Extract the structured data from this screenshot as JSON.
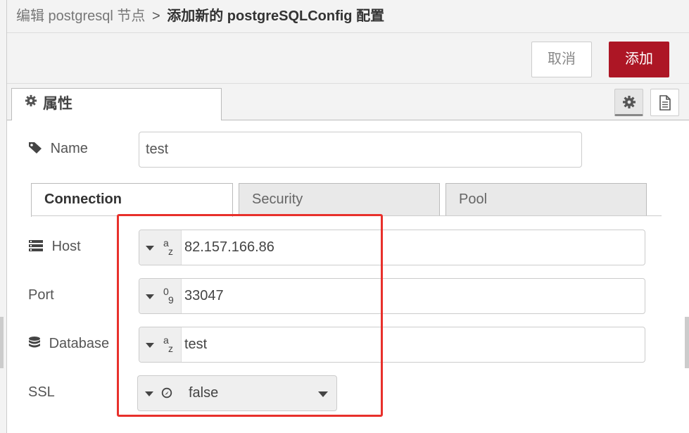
{
  "header": {
    "breadcrumb_parent": "编辑 postgresql 节点",
    "separator": ">",
    "breadcrumb_current": "添加新的 postgreSQLConfig 配置"
  },
  "toolbar": {
    "cancel_label": "取消",
    "add_label": "添加"
  },
  "tabs": {
    "properties_label": "属性"
  },
  "form": {
    "name_label": "Name",
    "name_value": "test",
    "subtabs": [
      "Connection",
      "Security",
      "Pool"
    ],
    "host_label": "Host",
    "host_value": "82.157.166.86",
    "host_type": "string",
    "port_label": "Port",
    "port_value": "33047",
    "port_type": "number",
    "database_label": "Database",
    "database_value": "test",
    "database_type": "string",
    "ssl_label": "SSL",
    "ssl_value": "false"
  },
  "colors": {
    "accent": "#ad1625",
    "highlight": "#e8302b"
  },
  "icons": {
    "properties": "gear-icon",
    "name": "tag-icon",
    "host": "server-icon",
    "database": "database-icon"
  }
}
